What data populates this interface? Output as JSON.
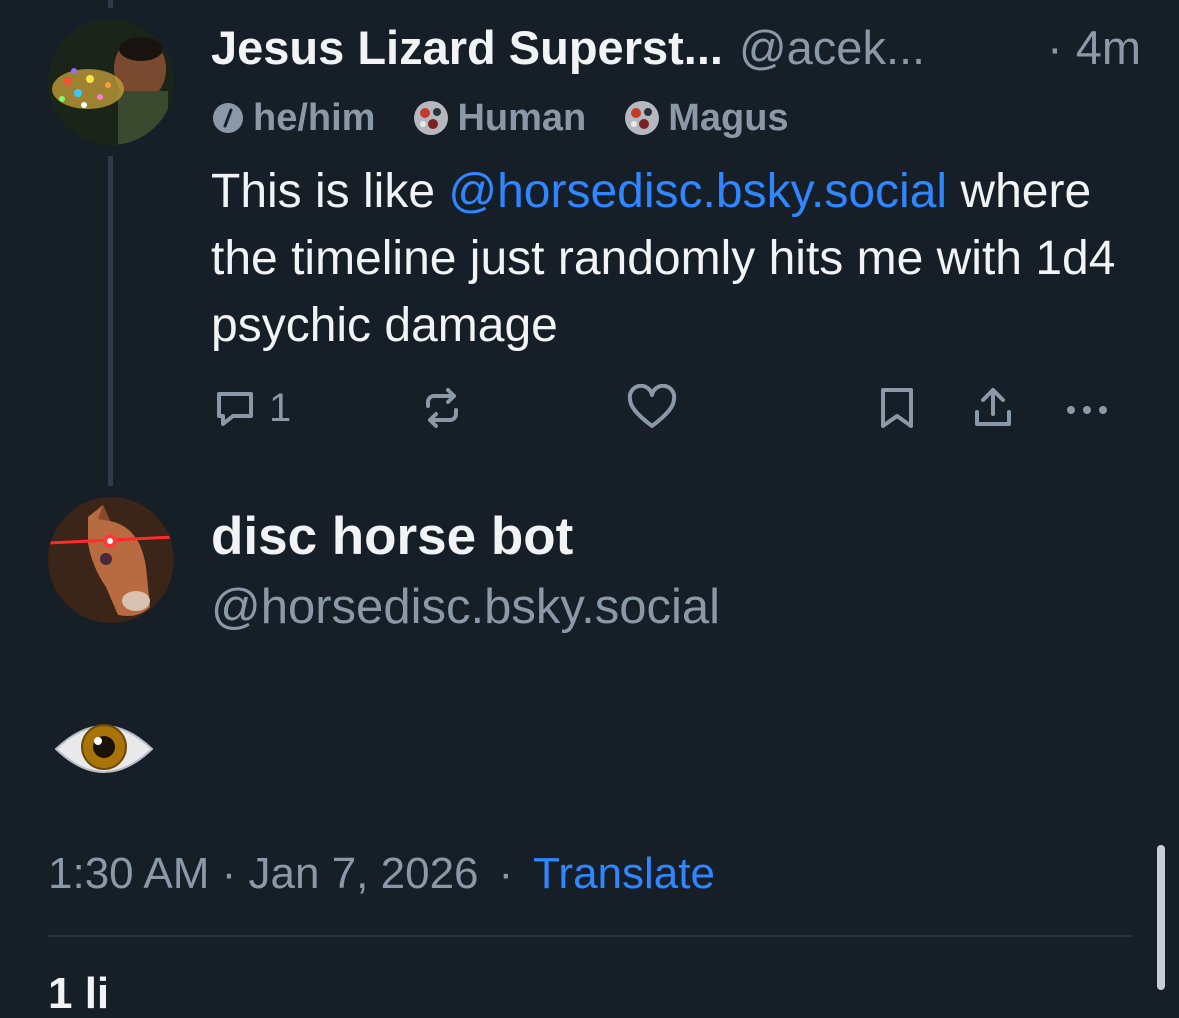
{
  "parent_post": {
    "display_name": "Jesus Lizard Superst...",
    "handle": "@acek...",
    "time": "· 4m",
    "labels": [
      {
        "text": "he/him",
        "icon": "pronoun-icon"
      },
      {
        "text": "Human",
        "icon": "label-avatar-icon"
      },
      {
        "text": "Magus",
        "icon": "label-avatar-icon"
      }
    ],
    "text_before": "This is like ",
    "mention": "@horsedisc.bsky.social",
    "text_after": " where the timeline just randomly hits me with 1d4 psychic damage",
    "reply_count": "1"
  },
  "main_post": {
    "display_name": "disc horse bot",
    "handle": "@horsedisc.bsky.social",
    "body_emoji": "eye-emoji",
    "timestamp": "1:30 AM · Jan 7, 2026",
    "separator": "·",
    "translate_label": "Translate",
    "likes_peek": "1 li"
  },
  "colors": {
    "background": "#161e27",
    "text": "#f1f3f5",
    "muted": "#8b98a7",
    "link": "#2f86ff"
  }
}
